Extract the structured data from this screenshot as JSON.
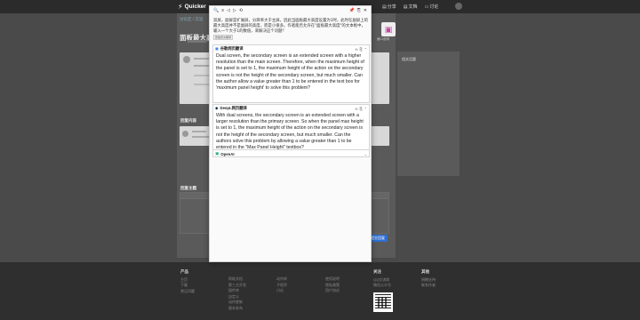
{
  "topbar": {
    "brand": "Quicker",
    "nav": [
      "分享",
      "文档",
      "讨论"
    ]
  },
  "page": {
    "breadcrumb": "讨论区 / 交流",
    "title": "面板最大高",
    "app_caption": "面CI说明"
  },
  "right_col_header": "相关话题",
  "sections": {
    "reply_title": "回复内容",
    "post_title": "回复主题",
    "submit_label": "提交回复"
  },
  "popup": {
    "toolbar_left": [
      "🔍",
      "≡",
      "◁",
      "▷",
      "⟲"
    ],
    "toolbar_right": [
      "📌",
      "⎘",
      "✕"
    ],
    "source_text": "双屏，副屏是扩展屏，分辨率大于主屏。因此当面板最大高度设置为1时，此时在副屏上的最大高度并不是副屏的高度，而是小很多。作者能否允许在\"面板最大高度\"的文本框中，输入一个大于1的数值，来解决这个问题？",
    "source_tag": "原始原文翻译",
    "panels": [
      {
        "name": "谷歌网页翻译",
        "icon": "google-translate-icon",
        "text": "Dual screen, the secondary screen is an extended screen with a higher resolution than the main screen. Therefore, when the maximum height of the panel is set to 1, the maximum height of the action on the secondary screen is not the height of the secondary screen, but much smaller. Can the author allow a value greater than 1 to be entered in the text box for 'maximum panel height' to solve this problem?"
      },
      {
        "name": "DeepL网页翻译",
        "icon": "deepl-icon",
        "text": "With dual screens, the secondary screen is an extended screen with a larger resolution than the primary screen. So when the panel max height is set to 1, the maximum height of the action on the secondary screen is not the height of the secondary screen, but much smaller. Can the authors solve this problem by allowing a value greater than 1 to be entered in the \"Max Panel Height\" textbox?"
      },
      {
        "name": "OpenAI",
        "icon": "openai-icon",
        "text": ""
      }
    ]
  },
  "footer": {
    "col1": {
      "title": "产品",
      "items": [
        "主页",
        "下载",
        "常见问题"
      ]
    },
    "col2": {
      "title": "",
      "items": [
        "帮助文档",
        "第三方开发",
        "插件库",
        "自定义",
        "动作更新",
        "版本发布"
      ]
    },
    "col3": {
      "title": "",
      "items": [
        "动作库",
        "子程序",
        "讨论"
      ]
    },
    "col4": {
      "title": "",
      "items": [
        "使用说明",
        "隐私政策",
        "用户协议"
      ]
    },
    "col5": {
      "title": "关注",
      "items": [
        "QQ交流群",
        "微信公众号"
      ]
    },
    "col6": {
      "title": "其他",
      "items": [
        "捐赠支持",
        "联系作者"
      ]
    }
  }
}
